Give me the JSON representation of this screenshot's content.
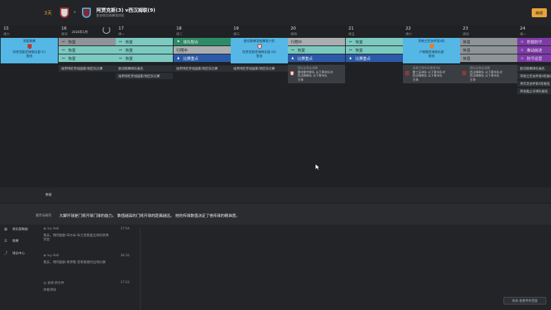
{
  "header": {
    "countdown": "3天",
    "match_title": "阿贾克斯(3) v西汉姆联(9)",
    "match_subtitle": "欧协联常规赛第四轮",
    "continue_label": "继续"
  },
  "calendar": {
    "month_label": "2026年1月",
    "days": [
      {
        "date": "15",
        "weekday": "周六"
      },
      {
        "date": "16",
        "weekday": "周日"
      },
      {
        "date": "17",
        "weekday": "周一"
      },
      {
        "date": "18",
        "weekday": "周二"
      },
      {
        "date": "19",
        "weekday": "周三"
      },
      {
        "date": "20",
        "weekday": "周四"
      },
      {
        "date": "21",
        "weekday": "周五"
      },
      {
        "date": "22",
        "weekday": "周六"
      },
      {
        "date": "23",
        "weekday": "周日"
      },
      {
        "date": "24",
        "weekday": "周一"
      }
    ],
    "col15": {
      "match_top": "英超联赛",
      "match_bottom": "阿贾克斯足球俱乐部 (F)",
      "match_tag": "客场"
    },
    "col16": {
      "r1": "恢复",
      "r2": "恢复",
      "r3": "恢复",
      "note": "候用待赶参加国家/地区队比赛"
    },
    "col17": {
      "r1": "恢复",
      "r2": "恢复",
      "r3": "恢复",
      "note1": "欧冠联赛球队报名",
      "note2": "候用待赶参加国家/地区队比赛"
    },
    "col18": {
      "r1": "球队配合",
      "r2": "行程中",
      "r3": "比赛重点",
      "note": "候用待赶参加国家/地区队比赛"
    },
    "col19": {
      "match_top": "欧冠联赛常规赛第六轮",
      "match_bottom": "阿贾克斯足球俱乐部 (D)",
      "match_tag": "客场",
      "note": "候用待赶参加国家/地区队比赛"
    },
    "col20": {
      "r1": "行程中",
      "r2": "恢复",
      "r3": "比赛重点",
      "res_title": "国际足联友谊赛",
      "res_l1": "曼彻斯特联队 以下青年队对",
      "res_l2": "西汉姆联队 以下青年队",
      "res_l3": "主场"
    },
    "col21": {
      "r1": "恢复",
      "r2": "恢复",
      "r3": "比赛重点"
    },
    "col22": {
      "match_top": "英格兰足总杯第4轮",
      "match_bottom": "卢顿镇足球俱乐部",
      "match_tag": "客场",
      "res_title": "英格兰青年队赛第4轮",
      "res_l1": "曼丁足球队 以下青年队对",
      "res_l2": "西汉姆联队 以下青年队",
      "res_l3": "主场"
    },
    "col23": {
      "r1": "休息",
      "r2": "休息",
      "r3": "休息",
      "res_title": "国际足联友谊赛",
      "res_l1": "西汉姆联队 以下青年队对",
      "res_l2": "西汉姆联队 以下青年队",
      "res_l3": "主场"
    },
    "col24": {
      "r1": "积极防守",
      "r2": "推动前进",
      "r3": "防守运营",
      "n1": "欧冠联赛球队报名",
      "n2": "英格兰足总杯第4轮报名",
      "n3": "青年足总杯第4轮报名",
      "n4": "转会截止日球队报名"
    }
  },
  "bottom": {
    "section_label": "数据",
    "tip_label": "提示与技巧",
    "tip_text": "大脚开球是门将开球门球的能力。 数值越高的门将开球的距离越远。 他的传球数值决定了他传球的精准度。",
    "sidebar": [
      {
        "label": "俱乐部数据"
      },
      {
        "label": "联赛"
      },
      {
        "label": "球员中心"
      }
    ],
    "messages": [
      {
        "sender": "Ivy Hall",
        "time": "17:54",
        "text": "我去，用阿图斯·布尔米·布兰普雷盘全场的新秀然后"
      },
      {
        "sender": "Ivy Hall",
        "time": "16:32",
        "text": "我去，用阿图斯·莱伊雷·普莱塞德的出场比赛"
      },
      {
        "sender": "会场·新文件",
        "time": "17:22",
        "text": "体能测试"
      }
    ],
    "chat_button": "发表·查看所有回复"
  }
}
